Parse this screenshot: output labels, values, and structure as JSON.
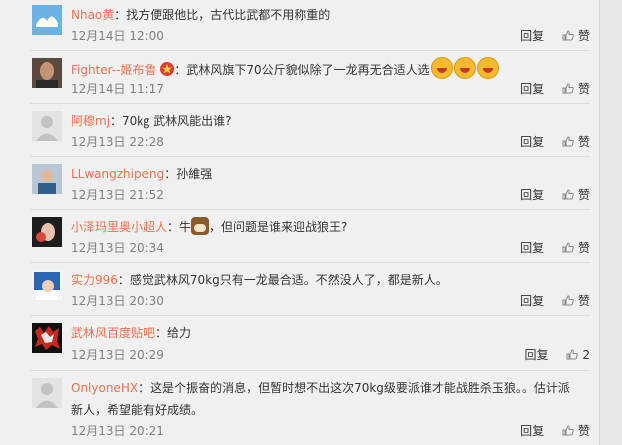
{
  "reply_label": "回复",
  "like_label": "赞",
  "comments": [
    {
      "name": "Nhao黄",
      "text": "：找方便跟他比，古代比武都不用称重的",
      "time": "12月14日 12:00",
      "like": "赞"
    },
    {
      "name": "Fighter--姬布鲁",
      "text": "：武林风旗下70公斤貌似除了一龙再无合适人选",
      "time": "12月14日 11:17",
      "like": "赞"
    },
    {
      "name": "阿穆mj",
      "text": "：70㎏ 武林风能出谁?",
      "time": "12月13日 22:28",
      "like": "赞"
    },
    {
      "name": "LLwangzhipeng",
      "text": "：孙維强",
      "time": "12月13日 21:52",
      "like": "赞"
    },
    {
      "name": "小泽玛里奥小超人",
      "text_a": "：牛",
      "text_b": "，但问题是谁来迎战狼王?",
      "time": "12月13日 20:34",
      "like": "赞"
    },
    {
      "name": "实力996",
      "text": "：感觉武林风70kg只有一龙最合适。不然没人了，都是新人。",
      "time": "12月13日 20:30",
      "like": "赞"
    },
    {
      "name": "武林风百度贴吧",
      "text": "：给力",
      "time": "12月13日 20:29",
      "like": "2"
    },
    {
      "name": "OnlyoneHX",
      "text": "：这是个振奋的消息，但暂时想不出这次70kg级要派谁才能战胜杀玉狼。。估计派新人，希望能有好成绩。",
      "time": "12月13日 20:21",
      "like": "赞"
    }
  ],
  "colors": {
    "name": "#eb7350",
    "muted": "#808080",
    "background": "#f0f0f0"
  }
}
